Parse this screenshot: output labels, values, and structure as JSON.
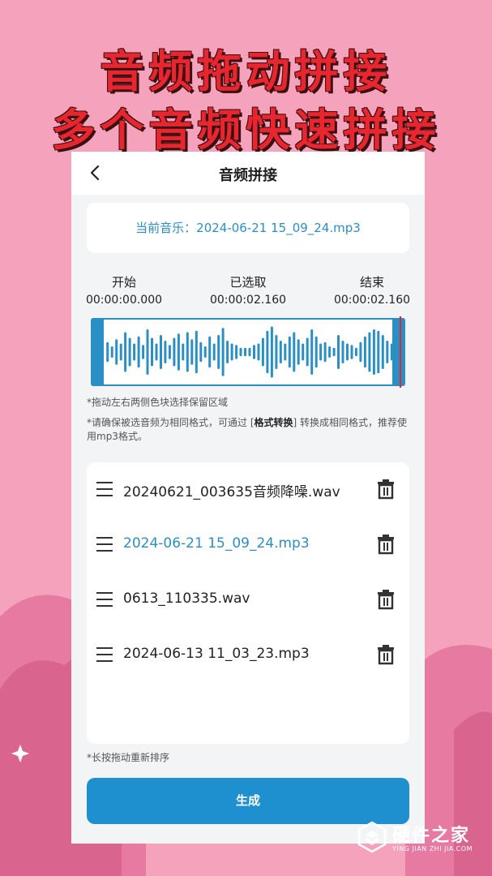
{
  "promo": {
    "headline_line1": "音频拖动拼接",
    "headline_line2": "多个音频快速拼接"
  },
  "header": {
    "back_icon": "chevron-left-icon",
    "title": "音频拼接"
  },
  "current": {
    "label": "当前音乐：2024-06-21 15_09_24.mp3"
  },
  "selection": {
    "start_label": "开始",
    "start_value": "00:00:00.000",
    "selected_label": "已选取",
    "selected_value": "00:00:02.160",
    "end_label": "结束",
    "end_value": "00:00:02.160"
  },
  "hints": {
    "drag_hint": "*拖动左右两侧色块选择保留区域",
    "format_hint_prefix": "*请确保被选音频为相同格式，可通过 [",
    "format_hint_bold": "格式转换",
    "format_hint_suffix": "] 转换成相同格式，推荐使用mp3格式。",
    "sort_hint": "*长按拖动重新排序"
  },
  "files": [
    {
      "name": "20240621_003635音频降噪.wav",
      "active": false
    },
    {
      "name": "2024-06-21 15_09_24.mp3",
      "active": true
    },
    {
      "name": "0613_110335.wav",
      "active": false
    },
    {
      "name": "2024-06-13 11_03_23.mp3",
      "active": false
    }
  ],
  "actions": {
    "generate_label": "生成"
  },
  "watermark": {
    "main": "硬件之家",
    "sub": "YING JIAN ZHI JIA.COM"
  },
  "colors": {
    "accent": "#2a8fc4",
    "button": "#1e90d0",
    "headline": "#e8262f",
    "background": "#f5a3bd",
    "playhead": "#e0262f"
  }
}
